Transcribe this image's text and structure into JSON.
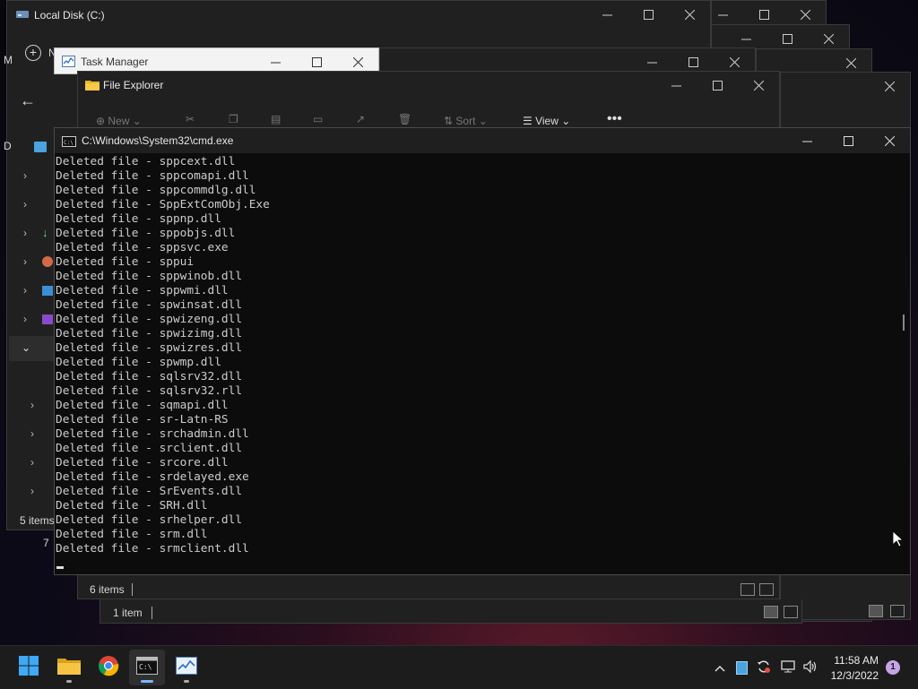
{
  "windows": {
    "back1": {
      "title": "Local Disk (C:)",
      "status": "5 items"
    },
    "task_manager": {
      "title": "Task Manager"
    },
    "file_explorer": {
      "title": "File Explorer",
      "toolbar": {
        "new_label": "New",
        "sort_label": "Sort",
        "view_label": "View"
      },
      "status": "6 items",
      "status2": "1 item",
      "partial": {
        "row1": "N",
        "row2": "M",
        "row3": "D",
        "row4": "7"
      }
    },
    "cmd": {
      "title": "C:\\Windows\\System32\\cmd.exe",
      "lines": [
        "Deleted file - sppcext.dll",
        "Deleted file - sppcomapi.dll",
        "Deleted file - sppcommdlg.dll",
        "Deleted file - SppExtComObj.Exe",
        "Deleted file - sppnp.dll",
        "Deleted file - sppobjs.dll",
        "Deleted file - sppsvc.exe",
        "Deleted file - sppui",
        "Deleted file - sppwinob.dll",
        "Deleted file - sppwmi.dll",
        "Deleted file - spwinsat.dll",
        "Deleted file - spwizeng.dll",
        "Deleted file - spwizimg.dll",
        "Deleted file - spwizres.dll",
        "Deleted file - spwmp.dll",
        "Deleted file - sqlsrv32.dll",
        "Deleted file - sqlsrv32.rll",
        "Deleted file - sqmapi.dll",
        "Deleted file - sr-Latn-RS",
        "Deleted file - srchadmin.dll",
        "Deleted file - srclient.dll",
        "Deleted file - srcore.dll",
        "Deleted file - srdelayed.exe",
        "Deleted file - SrEvents.dll",
        "Deleted file - SRH.dll",
        "Deleted file - srhelper.dll",
        "Deleted file - srm.dll",
        "Deleted file - srmclient.dll"
      ]
    }
  },
  "taskbar": {
    "apps": [
      {
        "name": "start",
        "icon": "windows-logo-icon"
      },
      {
        "name": "file-explorer",
        "icon": "folder-icon"
      },
      {
        "name": "chrome",
        "icon": "chrome-icon"
      },
      {
        "name": "cmd",
        "icon": "terminal-icon"
      },
      {
        "name": "task-manager",
        "icon": "task-manager-icon"
      }
    ],
    "time": "11:58 AM",
    "date": "12/3/2022",
    "notification_count": "1"
  },
  "colors": {
    "cmd_bg": "#0c0c0c",
    "cmd_text": "#cccccc",
    "taskbar_bg": "#1c1c1c",
    "accent": "#0078d4"
  }
}
